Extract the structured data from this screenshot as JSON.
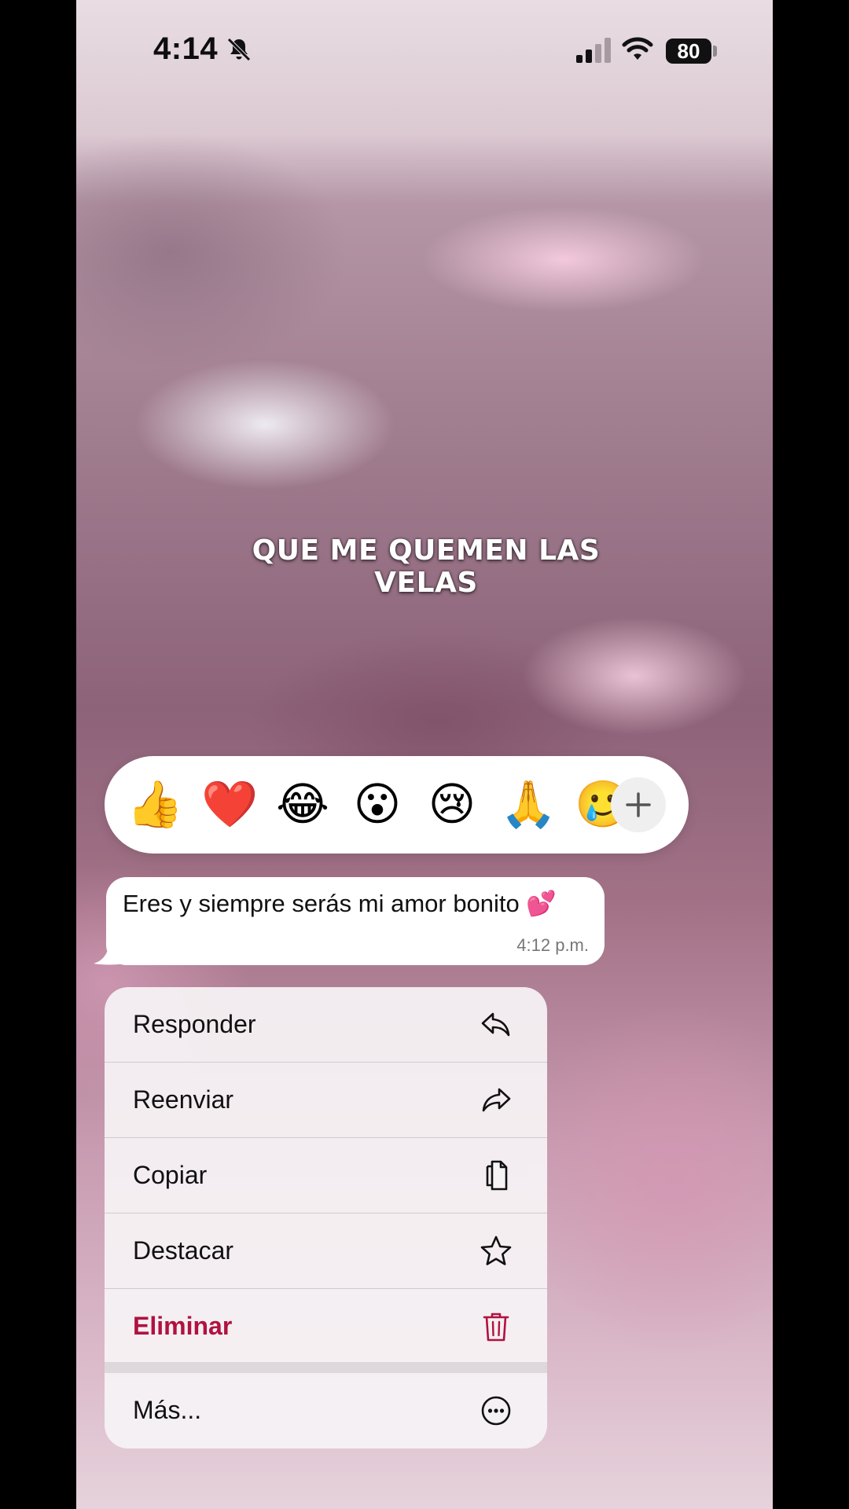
{
  "status_bar": {
    "time": "4:14",
    "battery": "80"
  },
  "overlay_caption": "QUE ME QUEMEN LAS VELAS",
  "reactions": [
    "👍",
    "❤️",
    "😂",
    "😮",
    "😢",
    "🙏",
    "🥲"
  ],
  "message": {
    "text": "Eres y siempre serás mi amor bonito 💕",
    "time": "4:12 p.m."
  },
  "menu": {
    "items": [
      {
        "label": "Responder",
        "icon": "reply-icon"
      },
      {
        "label": "Reenviar",
        "icon": "forward-icon"
      },
      {
        "label": "Copiar",
        "icon": "copy-icon"
      },
      {
        "label": "Destacar",
        "icon": "star-icon"
      },
      {
        "label": "Eliminar",
        "icon": "trash-icon",
        "color": "#b0123f"
      },
      {
        "label": "Más...",
        "icon": "more-icon"
      }
    ]
  },
  "colors": {
    "danger": "#b0123f",
    "bubble": "#ffffff",
    "menu_background": "#f6f3f5"
  }
}
